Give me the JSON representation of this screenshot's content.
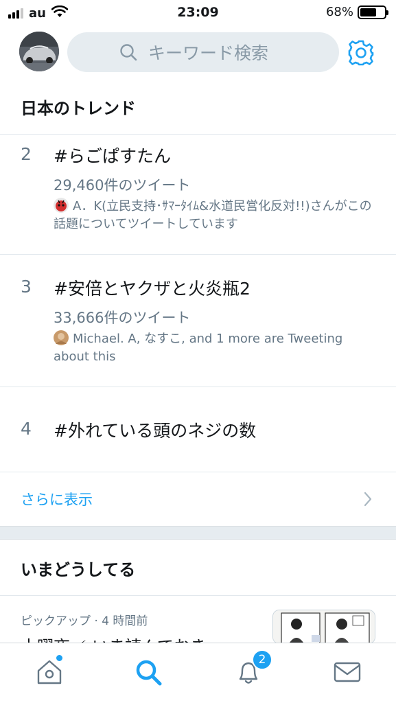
{
  "status_bar": {
    "carrier": "au",
    "time": "23:09",
    "battery_percent_text": "68%",
    "battery_level": 0.68,
    "signal_bars_on": 3,
    "signal_bars_total": 4
  },
  "header": {
    "search_placeholder": "キーワード検索"
  },
  "trends_section": {
    "title": "日本のトレンド",
    "items": [
      {
        "rank": "2",
        "name": "#らごぱすたん",
        "count": "29,460件のツイート",
        "context": "A．K(立民支持･ｻﾏｰﾀｲﾑ&水道民営化反対!!)さんがこの話題についてツイートしています"
      },
      {
        "rank": "3",
        "name": "#安倍とヤクザと火炎瓶2",
        "count": "33,666件のツイート",
        "context": "Michael. A, なすこ, and 1 more are Tweeting about this"
      },
      {
        "rank": "4",
        "name": "#外れている頭のネジの数"
      }
    ],
    "show_more": "さらに表示"
  },
  "happening_section": {
    "title": "いまどうしてる",
    "pickup_meta": "ピックアップ · 4 時間前",
    "pickup_headline": "土曜夜 ⚡ いま読んでおき"
  },
  "tab_bar": {
    "notification_badge": "2",
    "active_tab": "search"
  },
  "colors": {
    "accent": "#1da1f2",
    "secondary_text": "#657786",
    "search_bg": "#e6ecf0"
  }
}
